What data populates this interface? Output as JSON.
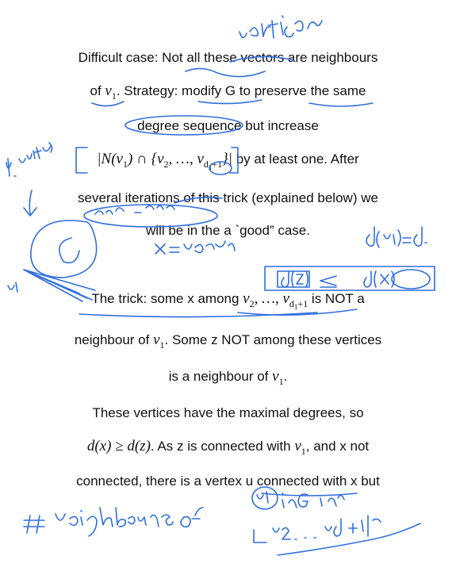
{
  "lines": {
    "l1": "Difficult case: Not all these vectors are neighbours",
    "l2_pre": "of",
    "l2_var": "v",
    "l2_sub": "1",
    "l2_post": ".  Strategy: modify G to preserve the same",
    "l3": "degree sequence but increase",
    "l4_set": "|N(v",
    "l4_sub1": "1",
    "l4_mid": ") ∩ {v",
    "l4_sub2": "2",
    "l4_dots": ", …, v",
    "l4_sub3": "d",
    "l4_sub3b": "1",
    "l4_sub3c": "+1",
    "l4_close": "}|",
    "l4_post": " by at least one. After",
    "l5": "several iterations of this trick (explained below) we",
    "l6": "will be in the a `good” case.",
    "l7_pre": "The trick: some x among ",
    "l7_var": "v",
    "l7_sub1": "2",
    "l7_dots": ", …, v",
    "l7_sub2": "d",
    "l7_sub2b": "1",
    "l7_sub2c": "+1",
    "l7_post": " is NOT a",
    "l8_pre": "neighbour of ",
    "l8_var": "v",
    "l8_sub": "1",
    "l8_post": ".  Some z NOT among these vertices",
    "l9_pre": "is a neighbour of ",
    "l9_var": "v",
    "l9_sub": "1",
    "l9_post": ".",
    "l10": "These vertices have the maximal degrees, so",
    "l11_math": "d(x) ≥ d(z)",
    "l11_mid": ".  As z is connected with ",
    "l11_var": "v",
    "l11_sub": "1",
    "l11_post": ",  and x not",
    "l12": "connected, there is a vertex u connected with x but"
  },
  "ink": {
    "color": "#2f6fde",
    "annotation_text": [
      "vertices",
      "d. vertices",
      "v1,v2, ... vd1+1",
      "x = v2 or v3",
      "d(v1) = d1",
      "d(z) ≤ d(x)",
      "v1",
      "# neighbours of v1 in G in",
      "Lv2, ... vd+1"
    ]
  }
}
